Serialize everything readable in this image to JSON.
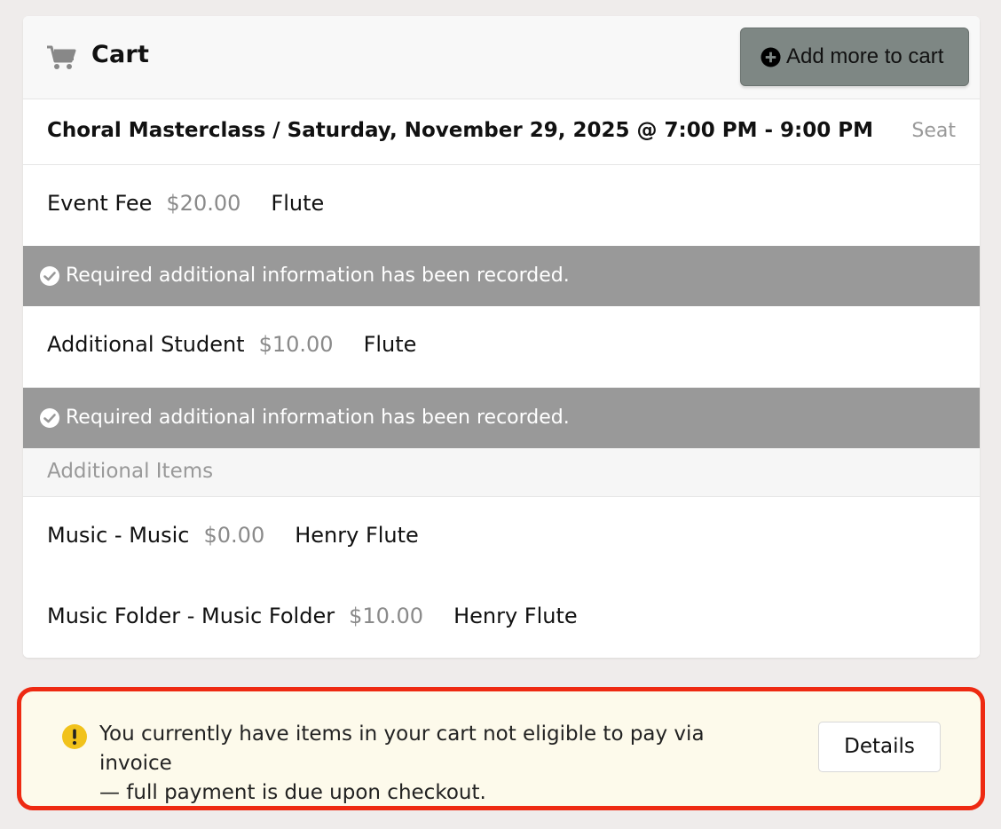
{
  "header": {
    "title": "Cart",
    "cart_icon": "cart-icon",
    "add_button_label": "Add more to cart",
    "add_button_icon": "plus-circle-icon"
  },
  "event": {
    "title": "Choral Masterclass / Saturday, November 29, 2025 @ 7:00 PM - 9:00 PM",
    "seat_label": "Seat"
  },
  "items": [
    {
      "name": "Event Fee",
      "price": "$20.00",
      "who": "Flute"
    },
    {
      "name": "Additional Student",
      "price": "$10.00",
      "who": "Flute"
    }
  ],
  "info_notice": {
    "text": "Required additional information has been recorded.",
    "icon": "check-circle-icon",
    "background": "#999999"
  },
  "additional_section": {
    "heading": "Additional Items",
    "items": [
      {
        "name": "Music - Music",
        "price": "$0.00",
        "who": "Henry Flute"
      },
      {
        "name": "Music Folder - Music Folder",
        "price": "$10.00",
        "who": "Henry Flute"
      }
    ]
  },
  "alert": {
    "icon": "warning-icon",
    "line1": "You currently have items in your cart not eligible to pay via invoice",
    "line2": "— full payment is due upon checkout.",
    "details_label": "Details",
    "highlight_color": "#ee2a12",
    "background": "#fdfaeb"
  }
}
